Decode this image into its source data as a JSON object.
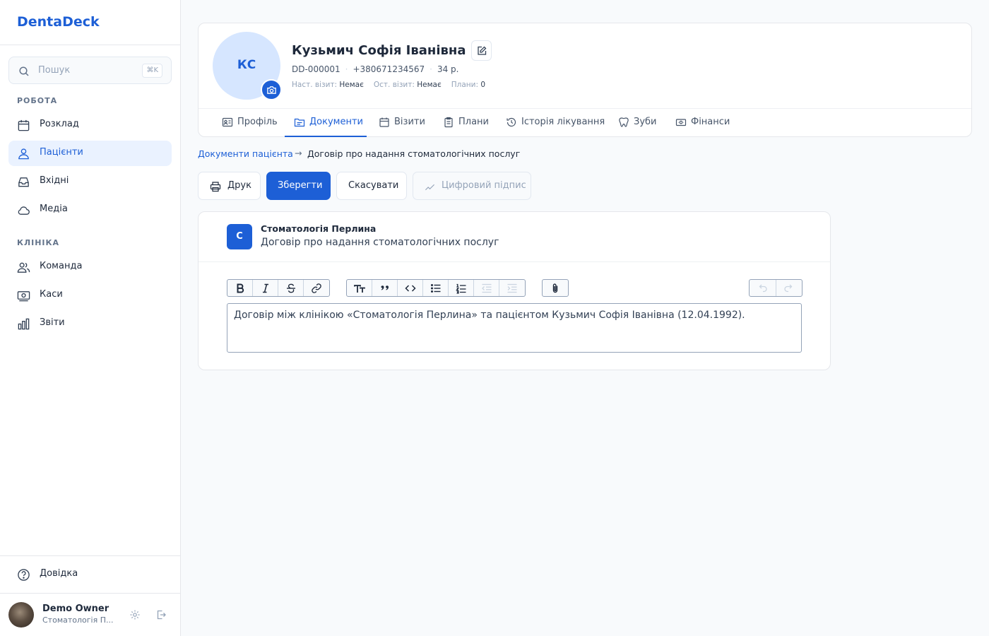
{
  "app": {
    "name": "DentaDeck"
  },
  "search": {
    "placeholder": "Пошук",
    "shortcut": "⌘K"
  },
  "sidebar": {
    "sections": [
      {
        "label": "РОБОТА",
        "items": [
          {
            "label": "Розклад",
            "icon": "calendar-icon"
          },
          {
            "label": "Пацієнти",
            "icon": "patients-icon",
            "active": true
          },
          {
            "label": "Вхідні",
            "icon": "inbox-icon"
          },
          {
            "label": "Медіа",
            "icon": "cloud-icon"
          }
        ]
      },
      {
        "label": "КЛІНІКА",
        "items": [
          {
            "label": "Команда",
            "icon": "team-icon"
          },
          {
            "label": "Каси",
            "icon": "cash-register-icon"
          },
          {
            "label": "Звіти",
            "icon": "chart-bars-icon"
          }
        ]
      }
    ],
    "help": "Довідка"
  },
  "user": {
    "name": "Demo Owner",
    "clinic": "Стоматологія П..."
  },
  "patient": {
    "initials": "КС",
    "name": "Кузьмич Софія Іванівна",
    "id": "DD-000001",
    "phone": "+380671234567",
    "age": "34 р.",
    "next_visit_label": "Наст. візит:",
    "next_visit": "Немає",
    "last_visit_label": "Ост. візит:",
    "last_visit": "Немає",
    "plans_label": "Плани:",
    "plans": "0"
  },
  "tabs": [
    {
      "label": "Профіль",
      "icon": "profile-card-icon"
    },
    {
      "label": "Документи",
      "icon": "folder-icon",
      "active": true
    },
    {
      "label": "Візити",
      "icon": "calendar-icon"
    },
    {
      "label": "Плани",
      "icon": "clipboard-icon"
    },
    {
      "label": "Історія лікування",
      "icon": "history-icon"
    },
    {
      "label": "Зуби",
      "icon": "tooth-icon"
    },
    {
      "label": "Фінанси",
      "icon": "money-icon"
    }
  ],
  "breadcrumb": {
    "parent": "Документи пацієнта",
    "arrow": "→",
    "current": "Договір про надання стоматологічних послуг"
  },
  "actions": {
    "print": "Друк",
    "save": "Зберегти",
    "cancel": "Скасувати",
    "sign": "Цифровий підпис"
  },
  "document": {
    "clinic_initial": "С",
    "clinic_name": "Стоматологія Перлина",
    "title": "Договір про надання стоматологічних послуг",
    "body": "Договір між клінікою «Стоматологія Перлина» та пацієнтом Кузьмич Софія Іванівна (12.04.1992)."
  },
  "toolbar": {
    "buttons": [
      "bold",
      "italic",
      "strikethrough",
      "link",
      "heading",
      "quote",
      "code",
      "bullet-list",
      "ordered-list",
      "outdent",
      "indent",
      "attachment",
      "undo",
      "redo"
    ]
  },
  "colors": {
    "accent": "#1d5fd6",
    "active_bg": "#eaf2ff"
  }
}
